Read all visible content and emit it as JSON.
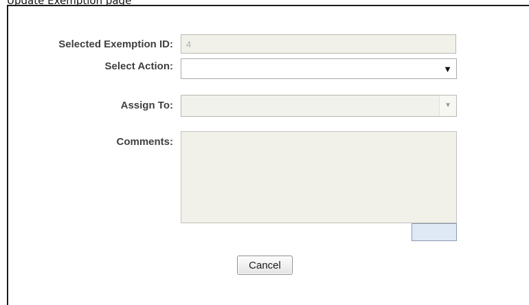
{
  "page_header": {
    "text": "Update Exemption page"
  },
  "form": {
    "exemption_id": {
      "label": "Selected Exemption ID:",
      "value": "4"
    },
    "select_action": {
      "label": "Select Action:",
      "value": "",
      "arrow_icon": "chevron-down-icon"
    },
    "assign_to": {
      "label": "Assign To:",
      "value": "",
      "arrow_icon": "chevron-down-icon"
    },
    "comments": {
      "label": "Comments:",
      "value": ""
    },
    "buttons": {
      "cancel_label": "Cancel"
    }
  },
  "colors": {
    "label_text": "#3f3f3f",
    "disabled_field_bg": "#f1f1ea",
    "dialog_border": "#1a1a1a",
    "accent_box": "#dfe8f5"
  }
}
